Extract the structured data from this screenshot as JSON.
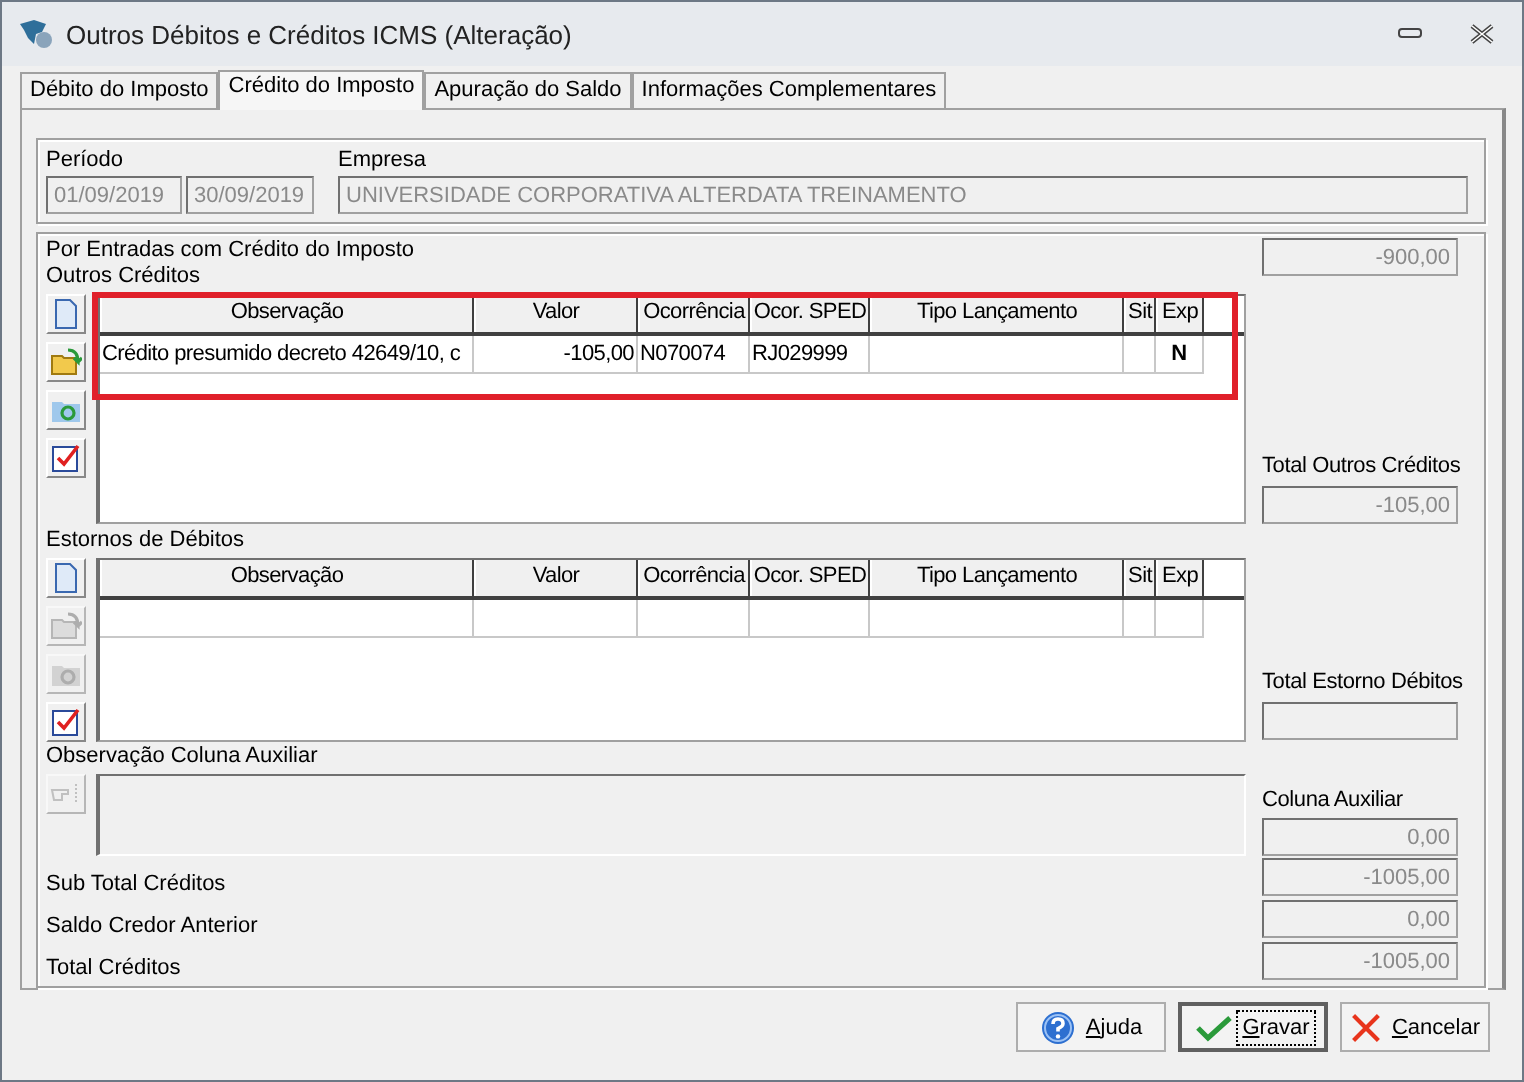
{
  "window": {
    "title": "Outros Débitos e Créditos ICMS (Alteração)"
  },
  "tabs": [
    {
      "label": "Débito do Imposto",
      "selected": false
    },
    {
      "label": "Crédito do Imposto",
      "selected": true
    },
    {
      "label": "Apuração do Saldo",
      "selected": false
    },
    {
      "label": "Informações Complementares",
      "selected": false
    }
  ],
  "periodo": {
    "label": "Período",
    "start": "01/09/2019",
    "end": "30/09/2019"
  },
  "empresa": {
    "label": "Empresa",
    "value": "UNIVERSIDADE CORPORATIVA ALTERDATA TREINAMENTO"
  },
  "entradas": {
    "label": "Por Entradas com Crédito do Imposto",
    "value": "-900,00"
  },
  "outros_creditos": {
    "label": "Outros Créditos",
    "highlighted": true,
    "tools": [
      {
        "kind": "new",
        "enabled": true
      },
      {
        "kind": "open",
        "enabled": true
      },
      {
        "kind": "refresh",
        "enabled": true
      },
      {
        "kind": "check",
        "enabled": true
      }
    ],
    "columns": [
      "Observação",
      "Valor",
      "Ocorrência",
      "Ocor. SPED",
      "Tipo Lançamento",
      "Sit",
      "Exp"
    ],
    "rows": [
      {
        "observacao": "Crédito presumido decreto 42649/10, c",
        "valor": "-105,00",
        "ocorrencia": "N070074",
        "ocor_sped": "RJ029999",
        "exp": "N"
      }
    ],
    "total_label": "Total Outros Créditos",
    "total": "-105,00"
  },
  "estornos": {
    "label": "Estornos de Débitos",
    "tools": [
      {
        "kind": "new",
        "enabled": true
      },
      {
        "kind": "open",
        "enabled": false
      },
      {
        "kind": "refresh",
        "enabled": false
      },
      {
        "kind": "check",
        "enabled": true
      }
    ],
    "columns": [
      "Observação",
      "Valor",
      "Ocorrência",
      "Ocor. SPED",
      "Tipo Lançamento",
      "Sit",
      "Exp"
    ],
    "total_label": "Total Estorno Débitos"
  },
  "observacao_auxiliar": {
    "label": "Observação Coluna Auxiliar",
    "button_enabled": false
  },
  "coluna_auxiliar": {
    "label": "Coluna Auxiliar",
    "value": "0,00"
  },
  "totals": [
    {
      "label": "Sub Total Créditos",
      "value": "-1005,00"
    },
    {
      "label": "Saldo Credor Anterior",
      "value": "0,00"
    },
    {
      "label": "Total Créditos",
      "value": "-1005,00"
    }
  ],
  "buttons": [
    {
      "label": "Ajuda",
      "kind": "help",
      "default": false
    },
    {
      "label": "Gravar",
      "kind": "save",
      "default": true
    },
    {
      "label": "Cancelar",
      "kind": "cancel",
      "default": false
    }
  ]
}
